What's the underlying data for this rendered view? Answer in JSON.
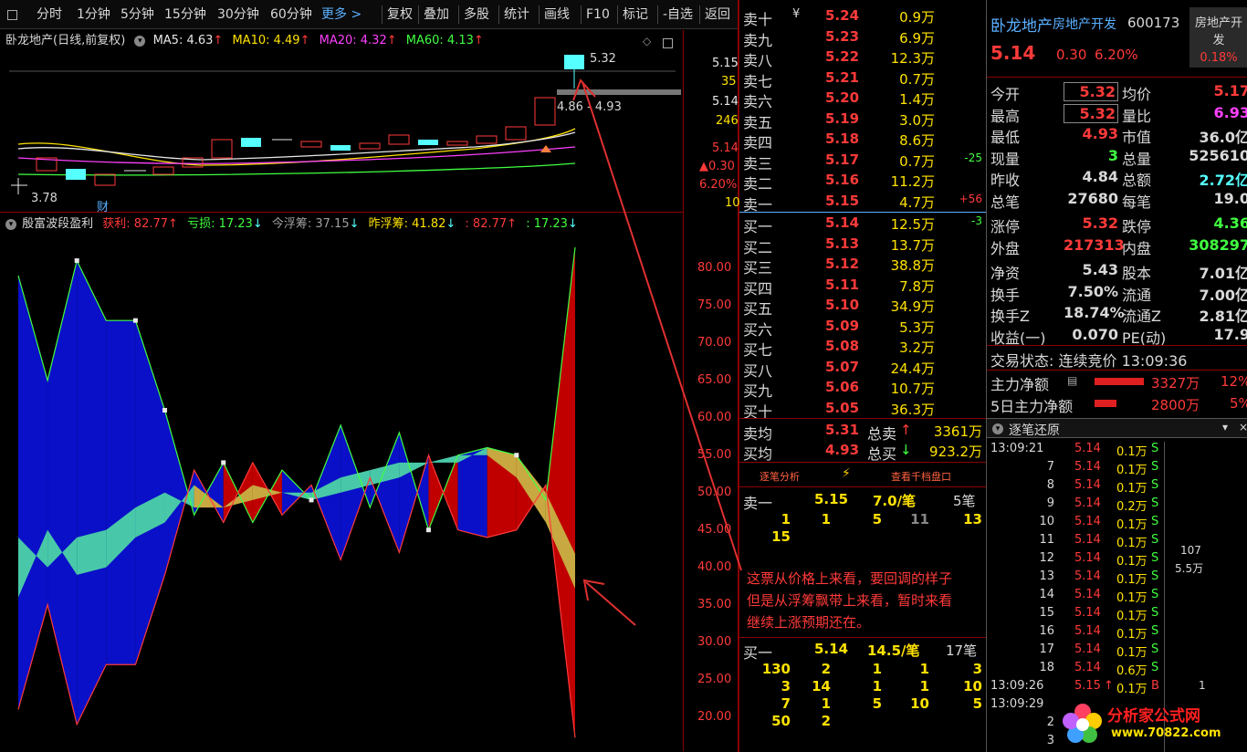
{
  "toolbar": {
    "items": [
      "分时",
      "1分钟",
      "5分钟",
      "15分钟",
      "30分钟",
      "60分钟",
      "更多 >",
      "复权",
      "叠加",
      "多股",
      "统计",
      "画线",
      "F10",
      "标记",
      "-自选",
      "返回"
    ]
  },
  "main_header": {
    "stock": "卧龙地产(日线,前复权)",
    "ma5": "MA5: 4.63",
    "ma10": "MA10: 4.49",
    "ma20": "MA20: 4.32",
    "ma60": "MA60: 4.13",
    "up_arrow": "↑"
  },
  "candle_labels": {
    "high": "5.32",
    "range": "4.86 - 4.93",
    "low": "3.78",
    "cai": "财"
  },
  "main_axis": {
    "v1": "5.15",
    "v1b": "35",
    "v2": "5.14",
    "v2b": "246",
    "v3": "5.14",
    "v3b": "▲0.30",
    "v3c": "6.20%",
    "v3d": "10"
  },
  "sub_header": {
    "name": "殷富波段盈利",
    "profit": "获利: 82.77",
    "loss": "亏损: 17.23",
    "today": "今浮筹: 37.15",
    "yest": "昨浮筹: 41.82",
    "v5": ": 82.77",
    "v6": ": 17.23",
    "up": "↑",
    "down": "↓"
  },
  "sub_axis": [
    "80.00",
    "75.00",
    "70.00",
    "65.00",
    "60.00",
    "55.00",
    "50.00",
    "45.00",
    "40.00",
    "35.00",
    "30.00",
    "25.00",
    "20.00"
  ],
  "chart_data": {
    "type": "area",
    "title": "殷富波段盈利",
    "ylim": [
      18,
      84
    ],
    "x": [
      0,
      1,
      2,
      3,
      4,
      5,
      6,
      7,
      8,
      9,
      10,
      11,
      12,
      13,
      14,
      15,
      16,
      17,
      18,
      19
    ],
    "series": [
      {
        "name": "获利",
        "values": [
          79,
          65,
          81,
          73,
          73,
          61,
          47,
          54,
          46,
          53,
          49,
          59,
          48,
          58,
          45,
          55,
          56,
          55,
          49,
          82.77
        ]
      },
      {
        "name": "亏损",
        "values": [
          21,
          35,
          19,
          27,
          27,
          39,
          53,
          46,
          54,
          47,
          51,
          41,
          52,
          42,
          55,
          45,
          44,
          45,
          51,
          17.23
        ]
      },
      {
        "name": "今浮筹",
        "values": [
          44,
          40,
          44,
          45,
          48,
          50,
          48,
          48,
          49,
          50,
          50,
          52,
          53,
          54,
          54,
          55,
          55,
          52,
          46,
          37.15
        ]
      },
      {
        "name": "昨浮筹",
        "values": [
          36,
          45,
          39,
          40,
          44,
          46,
          51,
          48,
          51,
          50,
          49,
          50,
          51,
          52,
          54,
          54,
          56,
          55,
          50,
          41.82
        ]
      }
    ]
  },
  "book": {
    "sells": [
      {
        "label": "卖十",
        "price": "5.24",
        "vol": "0.9万",
        "delta": "",
        "suffix": "¥"
      },
      {
        "label": "卖九",
        "price": "5.23",
        "vol": "6.9万",
        "delta": ""
      },
      {
        "label": "卖八",
        "price": "5.22",
        "vol": "12.3万",
        "delta": ""
      },
      {
        "label": "卖七",
        "price": "5.21",
        "vol": "0.7万",
        "delta": ""
      },
      {
        "label": "卖六",
        "price": "5.20",
        "vol": "1.4万",
        "delta": ""
      },
      {
        "label": "卖五",
        "price": "5.19",
        "vol": "3.0万",
        "delta": ""
      },
      {
        "label": "卖四",
        "price": "5.18",
        "vol": "8.6万",
        "delta": ""
      },
      {
        "label": "卖三",
        "price": "5.17",
        "vol": "0.7万",
        "delta": "-25"
      },
      {
        "label": "卖二",
        "price": "5.16",
        "vol": "11.2万",
        "delta": ""
      },
      {
        "label": "卖一",
        "price": "5.15",
        "vol": "4.7万",
        "delta": "+56"
      }
    ],
    "buys": [
      {
        "label": "买一",
        "price": "5.14",
        "vol": "12.5万",
        "delta": "-3"
      },
      {
        "label": "买二",
        "price": "5.13",
        "vol": "13.7万",
        "delta": ""
      },
      {
        "label": "买三",
        "price": "5.12",
        "vol": "38.8万",
        "delta": ""
      },
      {
        "label": "买四",
        "price": "5.11",
        "vol": "7.8万",
        "delta": ""
      },
      {
        "label": "买五",
        "price": "5.10",
        "vol": "34.9万",
        "delta": ""
      },
      {
        "label": "买六",
        "price": "5.09",
        "vol": "5.3万",
        "delta": ""
      },
      {
        "label": "买七",
        "price": "5.08",
        "vol": "3.2万",
        "delta": ""
      },
      {
        "label": "买八",
        "price": "5.07",
        "vol": "24.4万",
        "delta": ""
      },
      {
        "label": "买九",
        "price": "5.06",
        "vol": "10.7万",
        "delta": ""
      },
      {
        "label": "买十",
        "price": "5.05",
        "vol": "36.3万",
        "delta": ""
      }
    ],
    "avg": {
      "sell_label": "卖均",
      "sell_price": "5.31",
      "sell_total_label": "总卖",
      "sell_total": "3361万",
      "buy_label": "买均",
      "buy_price": "4.93",
      "buy_total_label": "总买",
      "buy_total": "923.2万"
    },
    "tabs": {
      "left": "逐笔分析",
      "right": "查看千档盘口"
    },
    "sell1": {
      "label": "卖一",
      "price": "5.15",
      "per": "7.0/笔",
      "count": "5笔",
      "orders": [
        "1",
        "1",
        "5",
        "11",
        "13",
        "15"
      ]
    },
    "annotation": [
      "这票从价格上来看，要回调的样子",
      "但是从浮筹飘带上来看，暂时来看",
      "继续上涨预期还在。"
    ],
    "buy1": {
      "label": "买一",
      "price": "5.14",
      "per": "14.5/笔",
      "count": "17笔",
      "orders": [
        "130",
        "2",
        "1",
        "1",
        "3",
        "3",
        "14",
        "1",
        "1",
        "10",
        "7",
        "1",
        "5",
        "10",
        "5",
        "50",
        "2"
      ]
    }
  },
  "info": {
    "name": "卧龙地产",
    "sector": "房地产开发",
    "code": "600173",
    "sector_tag1": "房地产开",
    "sector_tag2": "发",
    "price": "5.14",
    "change": "0.30",
    "pct": "6.20%",
    "sector_pct": "0.18%",
    "rows": [
      {
        "l": "今开",
        "v": "5.32",
        "l2": "均价",
        "v2": "5.17"
      },
      {
        "l": "最高",
        "v": "5.32",
        "l2": "量比",
        "v2": "6.93"
      },
      {
        "l": "最低",
        "v": "4.93",
        "l2": "市值",
        "v2": "36.0亿"
      },
      {
        "l": "现量",
        "v": "3",
        "l2": "总量",
        "v2": "525610"
      },
      {
        "l": "昨收",
        "v": "4.84",
        "l2": "总额",
        "v2": "2.72亿"
      },
      {
        "l": "总笔",
        "v": "27680",
        "l2": "每笔",
        "v2": "19.0"
      },
      {
        "l": "涨停",
        "v": "5.32",
        "l2": "跌停",
        "v2": "4.36"
      },
      {
        "l": "外盘",
        "v": "217313",
        "l2": "内盘",
        "v2": "308297"
      },
      {
        "l": "净资",
        "v": "5.43",
        "l2": "股本",
        "v2": "7.01亿"
      },
      {
        "l": "换手",
        "v": "7.50%",
        "l2": "流通",
        "v2": "7.00亿"
      },
      {
        "l": "换手Z",
        "v": "18.74%",
        "l2": "流通Z",
        "v2": "2.81亿"
      },
      {
        "l": "收益(一)",
        "v": "0.070",
        "l2": "PE(动)",
        "v2": "17.9"
      }
    ],
    "status": "交易状态: 连续竞价 13:09:36",
    "main_flow_label": "主力净额",
    "main_flow": "3327万",
    "main_flow_pct": "12%",
    "flow5_label": "5日主力净额",
    "flow5": "2800万",
    "flow5_pct": "5%",
    "ticks_title": "逐笔还原",
    "ticks": [
      {
        "t": "13:09:21",
        "p": "5.14",
        "v": "0.1万",
        "s": "S"
      },
      {
        "t": "7",
        "p": "5.14",
        "v": "0.1万",
        "s": "S"
      },
      {
        "t": "8",
        "p": "5.14",
        "v": "0.1万",
        "s": "S"
      },
      {
        "t": "9",
        "p": "5.14",
        "v": "0.2万",
        "s": "S"
      },
      {
        "t": "10",
        "p": "5.14",
        "v": "0.1万",
        "s": "S"
      },
      {
        "t": "11",
        "p": "5.14",
        "v": "0.1万",
        "s": "S"
      },
      {
        "t": "12",
        "p": "5.14",
        "v": "0.1万",
        "s": "S"
      },
      {
        "t": "13",
        "p": "5.14",
        "v": "0.1万",
        "s": "S"
      },
      {
        "t": "14",
        "p": "5.14",
        "v": "0.1万",
        "s": "S"
      },
      {
        "t": "15",
        "p": "5.14",
        "v": "0.1万",
        "s": "S"
      },
      {
        "t": "16",
        "p": "5.14",
        "v": "0.1万",
        "s": "S"
      },
      {
        "t": "17",
        "p": "5.14",
        "v": "0.1万",
        "s": "S"
      },
      {
        "t": "18",
        "p": "5.14",
        "v": "0.6万",
        "s": "S"
      },
      {
        "t": "13:09:26",
        "p": "5.15",
        "v": "0.1万",
        "s": "B"
      },
      {
        "t": "13:09:29",
        "p": "",
        "v": "",
        "s": ""
      },
      {
        "t": "2",
        "p": "",
        "v": "",
        "s": ""
      },
      {
        "t": "3",
        "p": "",
        "v": "",
        "s": ""
      }
    ],
    "bar_107": "107",
    "bar_55": "5.5万",
    "bar_1": "1",
    "watermark": "分析家公式网",
    "watermark_url": "www.70822.com"
  }
}
